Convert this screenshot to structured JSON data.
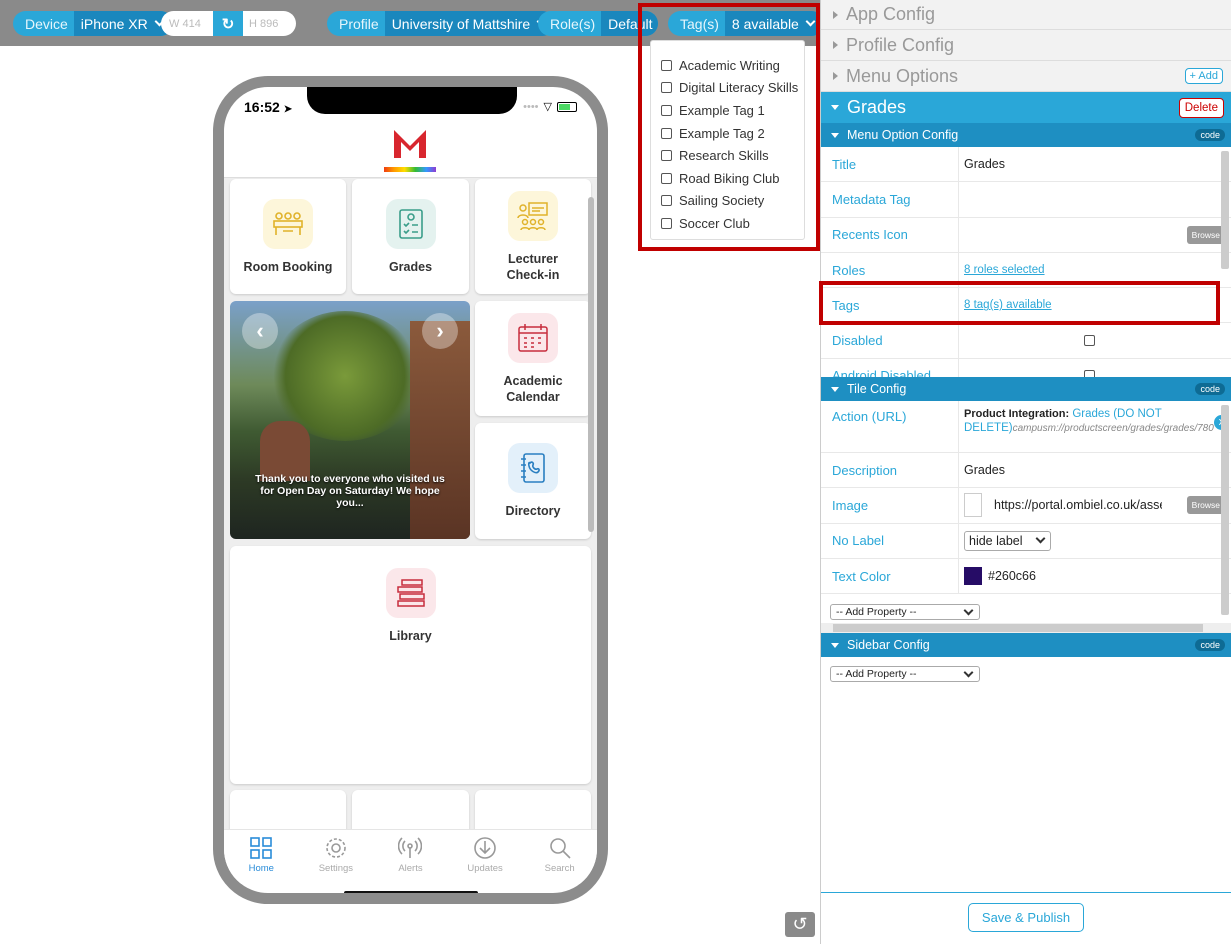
{
  "toolbar": {
    "device_label": "Device",
    "device_value": "iPhone XR",
    "width_label": "W",
    "width_value": "414",
    "height_label": "H",
    "height_value": "896",
    "profile_label": "Profile",
    "profile_value": "University of Mattshire",
    "roles_label": "Role(s)",
    "roles_value": "Default",
    "tags_label": "Tag(s)",
    "tags_value": "8 available"
  },
  "tag_dropdown": {
    "items": [
      "Academic Writing",
      "Digital Literacy Skills",
      "Example Tag 1",
      "Example Tag 2",
      "Research Skills",
      "Road Biking Club",
      "Sailing Society",
      "Soccer Club"
    ]
  },
  "phone": {
    "time": "16:52",
    "tiles": {
      "room_booking": "Room Booking",
      "grades": "Grades",
      "lecturer_checkin": "Lecturer Check-in",
      "academic_calendar": "Academic Calendar",
      "directory": "Directory",
      "library": "Library"
    },
    "carousel_caption": "Thank you to everyone who visited us for Open Day on Saturday! We hope you...",
    "tabs": [
      "Home",
      "Settings",
      "Alerts",
      "Updates",
      "Search"
    ]
  },
  "panel": {
    "app_config": "App Config",
    "profile_config": "Profile Config",
    "menu_options": "Menu Options",
    "add_label": "+ Add",
    "grades_title": "Grades",
    "delete_label": "Delete",
    "menu_option_config": "Menu Option Config",
    "code_label": "code",
    "menu_props": {
      "title_k": "Title",
      "title_v": "Grades",
      "metadata_k": "Metadata Tag",
      "recents_k": "Recents Icon",
      "browse": "Browse",
      "roles_k": "Roles",
      "roles_v": "8 roles selected",
      "tags_k": "Tags",
      "tags_v": "8 tag(s) available",
      "disabled_k": "Disabled",
      "android_k": "Android Disabled"
    },
    "tile_config": "Tile Config",
    "tile_props": {
      "action_k": "Action (URL)",
      "action_prefix": "Product Integration:",
      "action_link": "Grades (DO NOT DELETE)",
      "action_url": "campusm://productscreen/grades/grades/780",
      "close_label": "x",
      "description_k": "Description",
      "description_v": "Grades",
      "image_k": "Image",
      "image_v": "https://portal.ombiel.co.uk/assets",
      "nolabel_k": "No Label",
      "nolabel_v": "hide label",
      "textcolor_k": "Text Color",
      "textcolor_v": "#260c66",
      "add_property": "-- Add Property --"
    },
    "sidebar_config": "Sidebar Config",
    "sidebar_add_property": "-- Add Property --",
    "save_publish": "Save & Publish"
  },
  "colors": {
    "accent": "#2aa7d8",
    "accent_dark": "#1a87bd",
    "highlight": "#c00000",
    "text_color_swatch": "#260c66"
  }
}
